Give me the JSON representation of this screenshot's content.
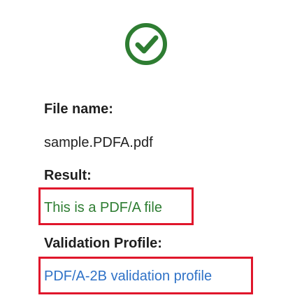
{
  "status": {
    "icon": "check-circle-icon",
    "color": "#2e7d32"
  },
  "file": {
    "label": "File name:",
    "value": "sample.PDFA.pdf"
  },
  "result": {
    "label": "Result:",
    "value": "This is a PDF/A file",
    "color": "#2e7d32"
  },
  "validation": {
    "label": "Validation Profile:",
    "value": "PDF/A-2B validation profile",
    "color": "#2f72c7"
  },
  "highlight_color": "#e0162b"
}
